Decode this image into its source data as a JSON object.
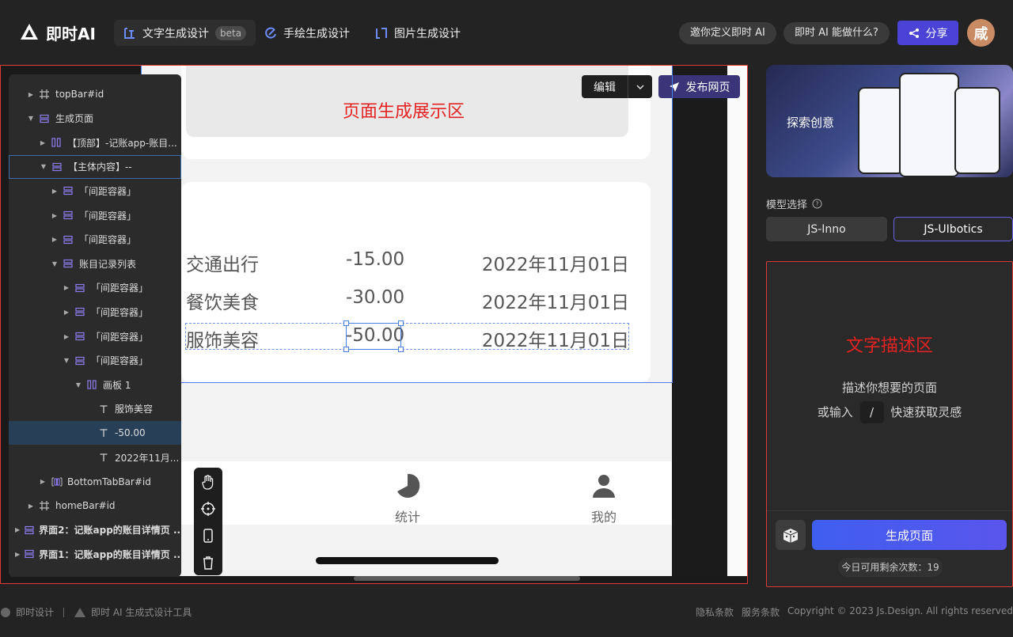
{
  "header": {
    "logo_text": "即时AI",
    "nav": [
      {
        "label": "文字生成设计",
        "badge": "beta",
        "active": true
      },
      {
        "label": "手绘生成设计"
      },
      {
        "label": "图片生成设计"
      }
    ],
    "invite_label": "邀你定义即时 AI",
    "whatcan_label": "即时 AI 能做什么?",
    "share_label": "分享",
    "avatar_text": "咸"
  },
  "canvas": {
    "area_title": "页面生成展示区",
    "edit_label": "编辑",
    "publish_label": "发布网页",
    "records": [
      {
        "category": "交通出行",
        "amount": "-15.00",
        "date": "2022年11月01日"
      },
      {
        "category": "餐饮美食",
        "amount": "-30.00",
        "date": "2022年11月01日"
      },
      {
        "category": "服饰美容",
        "amount": "-50.00",
        "date": "2022年11月01日"
      }
    ],
    "tabs": [
      {
        "label": "统计",
        "icon": "pie-chart-icon"
      },
      {
        "label": "我的",
        "icon": "user-icon"
      }
    ]
  },
  "layers": [
    {
      "label": "topBar#id",
      "icon": "frame",
      "level": 1,
      "arrow": "right"
    },
    {
      "label": "生成页面",
      "icon": "stack",
      "level": 1,
      "arrow": "down"
    },
    {
      "label": "【顶部】-记账app-账目...",
      "icon": "columns",
      "level": 2,
      "arrow": "right"
    },
    {
      "label": "【主体内容】--",
      "icon": "stack",
      "level": 2,
      "arrow": "down",
      "outlined": true
    },
    {
      "label": "「间距容器」",
      "icon": "stack",
      "level": 3,
      "arrow": "right"
    },
    {
      "label": "「间距容器」",
      "icon": "stack",
      "level": 3,
      "arrow": "right"
    },
    {
      "label": "「间距容器」",
      "icon": "stack",
      "level": 3,
      "arrow": "right"
    },
    {
      "label": "账目记录列表",
      "icon": "stack",
      "level": 3,
      "arrow": "down"
    },
    {
      "label": "「间距容器」",
      "icon": "stack",
      "level": 4,
      "arrow": "right"
    },
    {
      "label": "「间距容器」",
      "icon": "stack",
      "level": 4,
      "arrow": "right"
    },
    {
      "label": "「间距容器」",
      "icon": "stack",
      "level": 4,
      "arrow": "right"
    },
    {
      "label": "「间距容器」",
      "icon": "stack",
      "level": 4,
      "arrow": "down"
    },
    {
      "label": "画板 1",
      "icon": "columns",
      "level": 5,
      "arrow": "down"
    },
    {
      "label": "服饰美容",
      "icon": "text",
      "level": 6,
      "arrow": ""
    },
    {
      "label": "-50.00",
      "icon": "text",
      "level": 6,
      "arrow": "",
      "selected": true
    },
    {
      "label": "2022年11月...",
      "icon": "text",
      "level": 6,
      "arrow": ""
    },
    {
      "label": "BottomTabBar#id",
      "icon": "columns-frame",
      "level": 2,
      "arrow": "right"
    },
    {
      "label": "homeBar#id",
      "icon": "frame",
      "level": 1,
      "arrow": "right"
    },
    {
      "label": "界面2：记账app的账目详情页 ...",
      "icon": "stack",
      "level": 0,
      "arrow": "right",
      "bold": true
    },
    {
      "label": "界面1：记账app的账目详情页 ...",
      "icon": "stack",
      "level": 0,
      "arrow": "right",
      "bold": true
    }
  ],
  "right": {
    "banner_text": "探索创意",
    "model_label": "模型选择",
    "models": [
      {
        "label": "JS-Inno",
        "active": false
      },
      {
        "label": "JS-UIbotics",
        "active": true
      }
    ],
    "desc_title": "文字描述区",
    "desc_line1": "描述你想要的页面",
    "desc_line2_a": "或输入",
    "desc_slash": "/",
    "desc_line2_b": "快速获取灵感",
    "generate_label": "生成页面",
    "remaining_label": "今日可用剩余次数：",
    "remaining_count": "19"
  },
  "footer": {
    "brand1": "即时设计",
    "brand2": "即时 AI 生成式设计工具",
    "privacy": "隐私条款",
    "service": "服务条款",
    "copyright": "Copyright © 2023 Js.Design. All rights reserved"
  },
  "colors": {
    "accent": "#4b42d6",
    "highlight_red": "#e52222",
    "selection_blue": "#4a7fe6"
  }
}
